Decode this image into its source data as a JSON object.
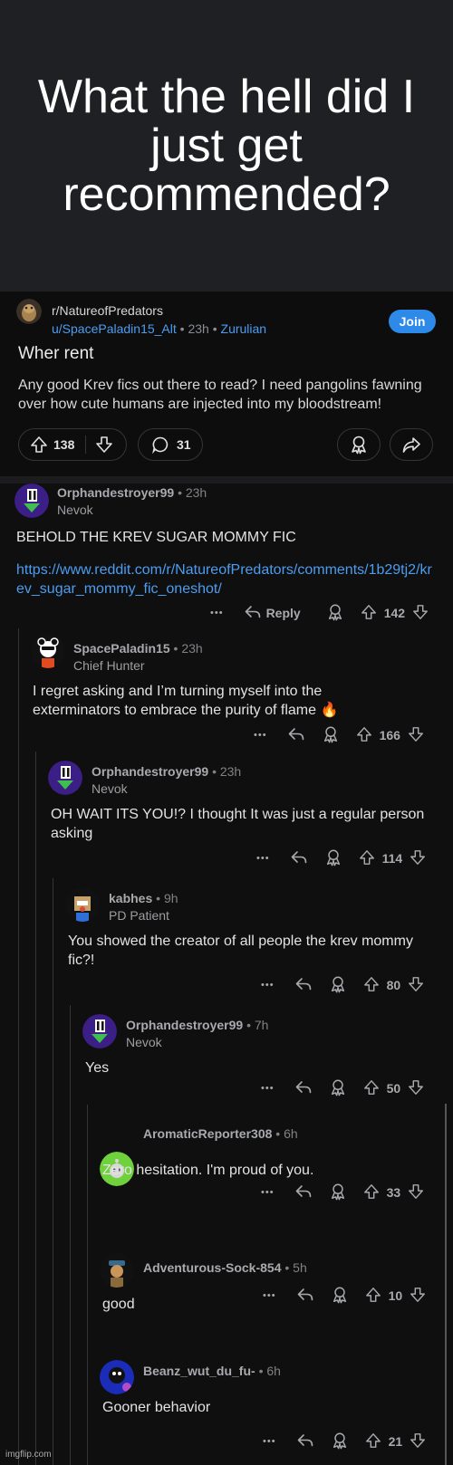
{
  "meme_title": "What the hell did I just get recommended?",
  "post": {
    "subreddit": "r/NatureofPredators",
    "author": "u/SpacePaladin15_Alt",
    "separator": "•",
    "time": "23h",
    "flair": "Zurulian",
    "join_label": "Join",
    "title": "Wher rent",
    "body": "Any good Krev fics out there to read? I need pangolins fawning over how cute humans are injected into my bloodstream!",
    "upvotes": "138",
    "comments": "31"
  },
  "comments": [
    {
      "author": "Orphandestroyer99",
      "time": "23h",
      "flair": "Nevok",
      "body": "BEHOLD THE KREV SUGAR MOMMY FIC",
      "link": "https://www.reddit.com/r/NatureofPredators/comments/1b29tj2/krev_sugar_mommy_fic_oneshot/",
      "reply_label": "Reply",
      "score": "142"
    },
    {
      "author": "SpacePaladin15",
      "time": "23h",
      "flair": "Chief Hunter",
      "body": "I regret asking and I’m turning myself into the exterminators to embrace the purity of flame 🔥",
      "score": "166"
    },
    {
      "author": "Orphandestroyer99",
      "time": "23h",
      "flair": "Nevok",
      "body": "OH WAIT ITS YOU!? I thought It was just a regular person asking",
      "score": "114"
    },
    {
      "author": "kabhes",
      "time": "9h",
      "flair": "PD Patient",
      "body": "You showed the creator of all people the krev mommy fic?!",
      "score": "80"
    },
    {
      "author": "Orphandestroyer99",
      "time": "7h",
      "flair": "Nevok",
      "body": "Yes",
      "score": "50"
    },
    {
      "author": "AromaticReporter308",
      "time": "6h",
      "body": "Zero hesitation. I'm proud of you.",
      "score": "33"
    },
    {
      "author": "Adventurous-Sock-854",
      "time": "5h",
      "body": "good",
      "score": "10"
    },
    {
      "author": "Beanz_wut_du_fu-",
      "time": "6h",
      "body": "Gooner behavior",
      "score": "21"
    }
  ],
  "more_icon_text": "•••",
  "watermark": "imgflip.com",
  "colors": {
    "accent": "#2d8ae8",
    "link": "#4c9df0",
    "background": "#0f0f10",
    "banner": "#1f2023"
  }
}
